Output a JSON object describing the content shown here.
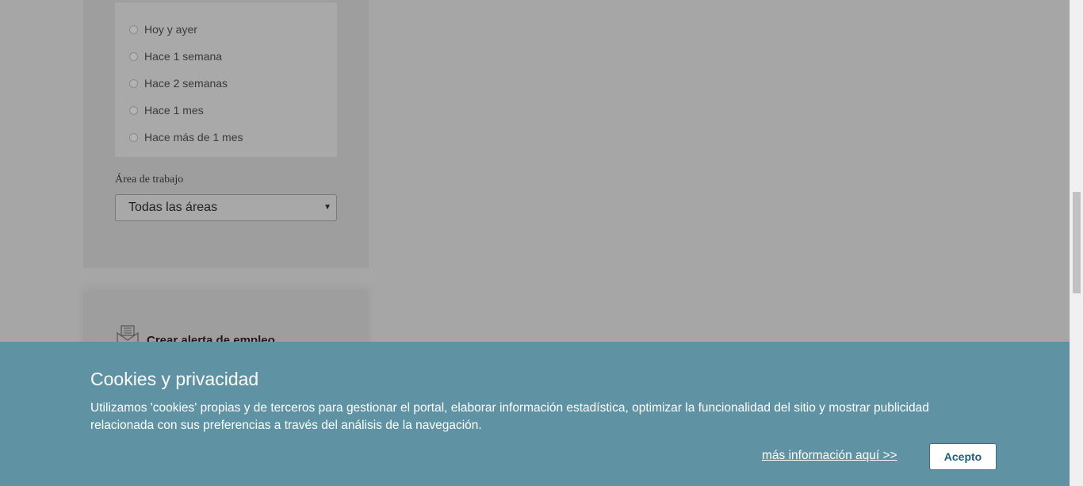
{
  "filters": {
    "date_options": [
      {
        "label": "Hoy y ayer"
      },
      {
        "label": "Hace 1 semana"
      },
      {
        "label": "Hace 2 semanas"
      },
      {
        "label": "Hace 1 mes"
      },
      {
        "label": "Hace más de 1 mes"
      }
    ],
    "area": {
      "label": "Área de trabajo",
      "selected": "Todas las áreas"
    }
  },
  "alert": {
    "title": "Crear alerta de empleo",
    "icon": "mail-alert-icon"
  },
  "cookies": {
    "title": "Cookies y privacidad",
    "text": "Utilizamos 'cookies' propias y de terceros para gestionar el portal, elaborar información estadística, optimizar la funcionalidad del sitio y mostrar publicidad relacionada con sus preferencias a través del análisis de la navegación.",
    "more_link": "más información aquí >> ",
    "accept_label": "Acepto",
    "background_color": "#5f93a4"
  }
}
